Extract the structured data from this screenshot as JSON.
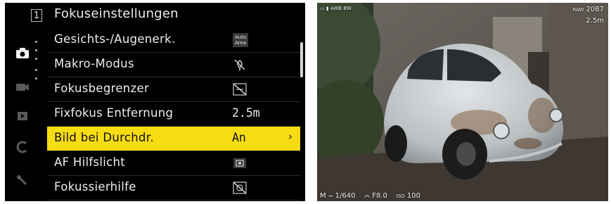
{
  "menu": {
    "page_number": "1",
    "title": "Fokuseinstellungen",
    "sidebar": {
      "tabs": [
        {
          "icon": "camera-icon",
          "active": true
        },
        {
          "icon": "video-camera-icon",
          "active": false
        },
        {
          "icon": "playback-icon",
          "active": false
        },
        {
          "icon": "custom-c-icon",
          "active": false
        },
        {
          "icon": "wrench-icon",
          "active": false
        }
      ]
    },
    "items": [
      {
        "label": "Gesichts-/Augenerk.",
        "value_icon": "auto-area-icon",
        "value_text": "Auto Area"
      },
      {
        "label": "Makro-Modus",
        "value_icon": "macro-off-icon"
      },
      {
        "label": "Fokusbegrenzer",
        "value_icon": "focus-limiter-off-icon"
      },
      {
        "label": "Fixfokus Entfernung",
        "value": "2.5m"
      },
      {
        "label": "Bild bei Durchdr.",
        "value": "An",
        "selected": true
      },
      {
        "label": "AF Hilfslicht",
        "value_icon": "af-assist-light-icon"
      },
      {
        "label": "Fokussierhilfe",
        "value_icon": "focus-aid-off-icon"
      }
    ],
    "colors": {
      "highlight": "#f6dc13",
      "background": "#000000",
      "text": "#eeeeee"
    }
  },
  "liveview": {
    "top_left": {
      "wb": "AWB BW"
    },
    "top_right": {
      "format": "RAW",
      "shots_remaining": "2087",
      "focus_distance": "2.5m"
    },
    "bottom": {
      "mode": "M",
      "shutter": "1/640",
      "aperture": "F8.0",
      "iso_label": "ISO",
      "iso": "100"
    }
  }
}
